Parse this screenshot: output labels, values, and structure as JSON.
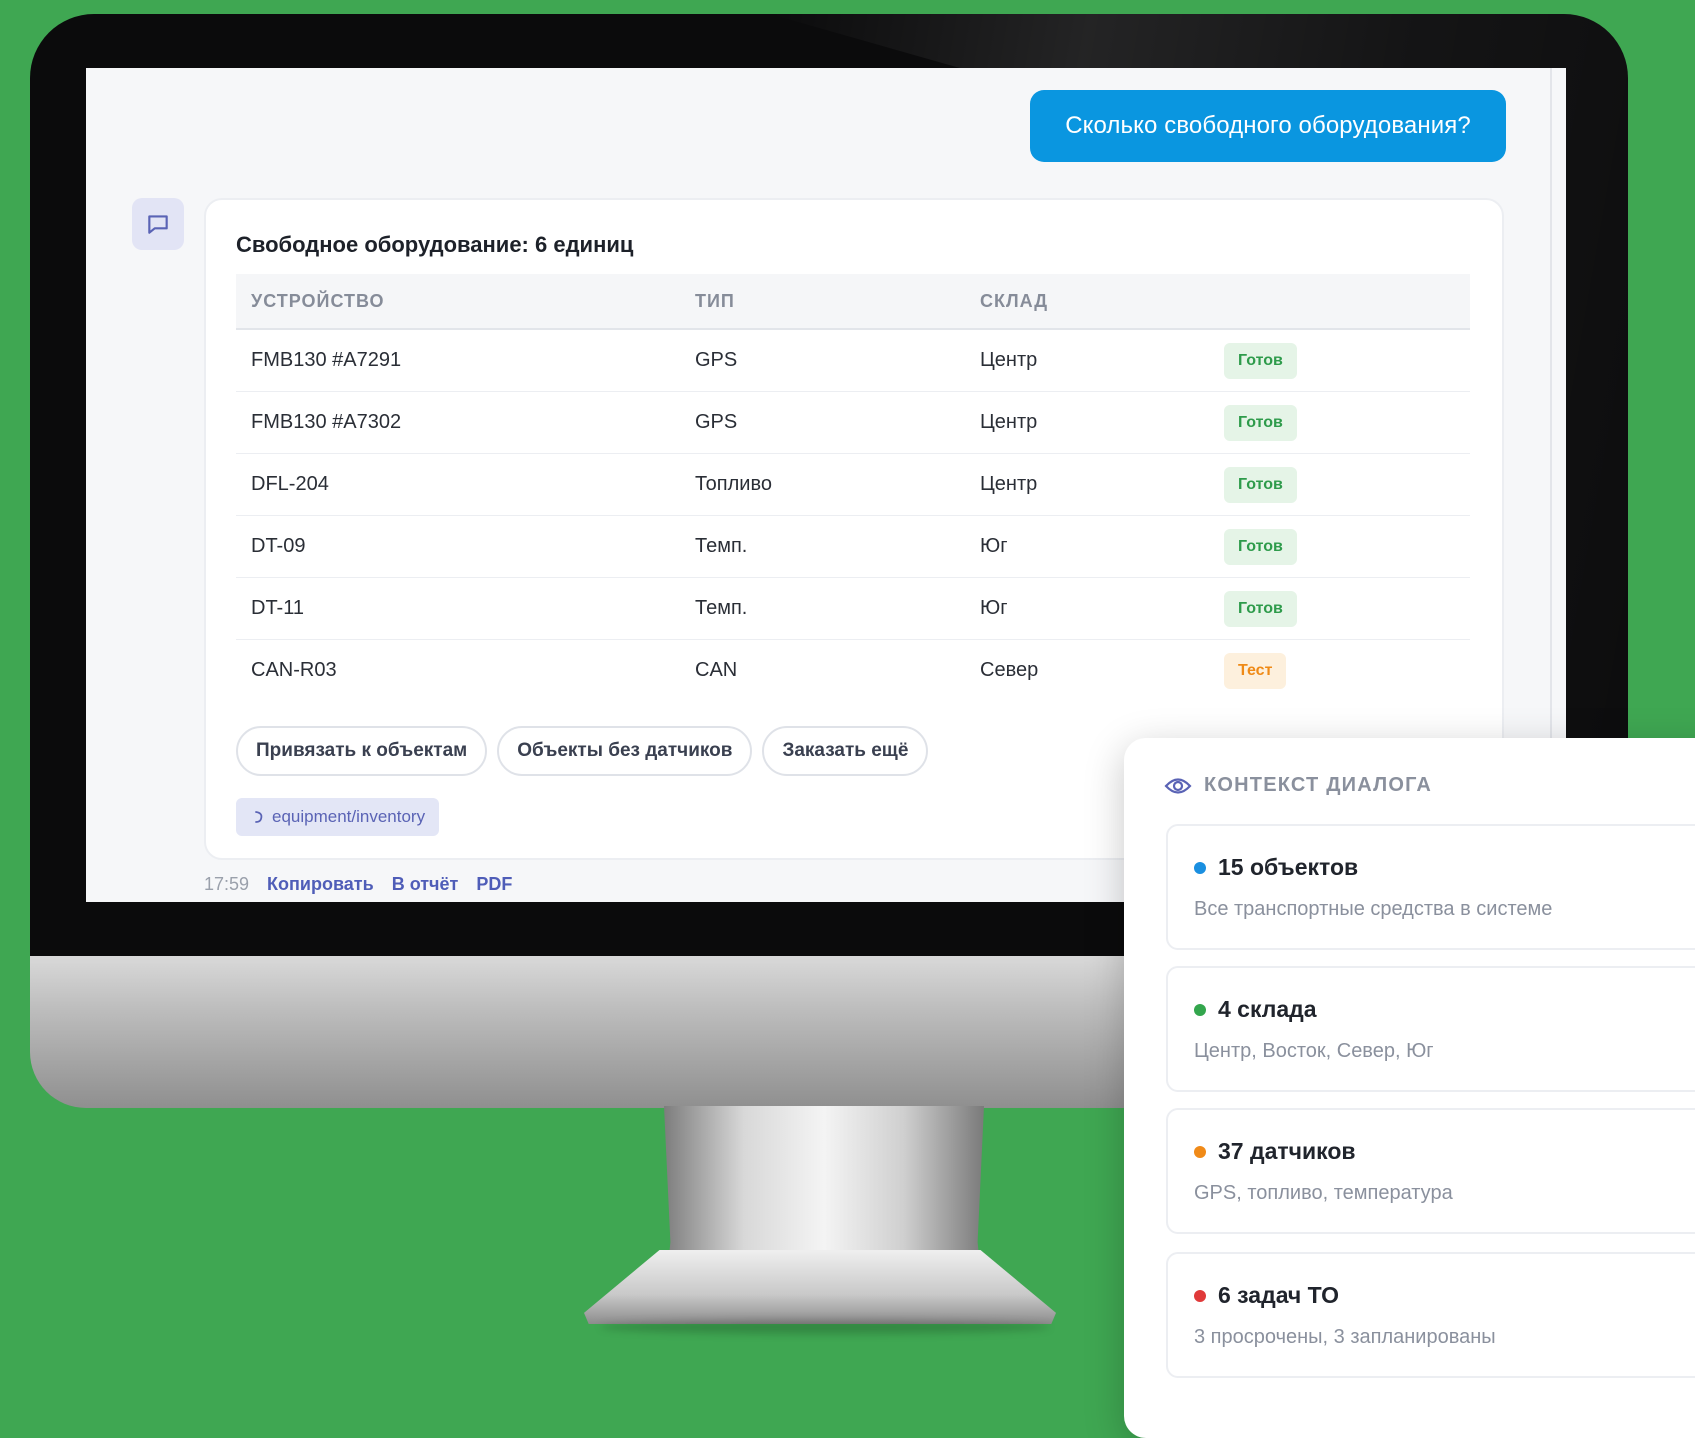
{
  "chat": {
    "user_message": "Сколько свободного оборудования?",
    "response_title": "Свободное оборудование: 6 единиц",
    "table": {
      "columns": [
        "УСТРОЙСТВО",
        "ТИП",
        "СКЛАД"
      ],
      "rows": [
        {
          "device": "FMB130 #A7291",
          "type": "GPS",
          "warehouse": "Центр",
          "status": "Готов"
        },
        {
          "device": "FMB130 #A7302",
          "type": "GPS",
          "warehouse": "Центр",
          "status": "Готов"
        },
        {
          "device": "DFL-204",
          "type": "Топливо",
          "warehouse": "Центр",
          "status": "Готов"
        },
        {
          "device": "DT-09",
          "type": "Темп.",
          "warehouse": "Юг",
          "status": "Готов"
        },
        {
          "device": "DT-11",
          "type": "Темп.",
          "warehouse": "Юг",
          "status": "Готов"
        },
        {
          "device": "CAN-R03",
          "type": "CAN",
          "warehouse": "Север",
          "status": "Тест"
        }
      ]
    },
    "actions": [
      "Привязать к объектам",
      "Объекты без датчиков",
      "Заказать ещё"
    ],
    "source_tag": "equipment/inventory",
    "meta": {
      "time": "17:59",
      "copy": "Копировать",
      "to_report": "В отчёт",
      "pdf": "PDF"
    }
  },
  "context": {
    "title": "КОНТЕКСТ ДИАЛОГА",
    "cards": [
      {
        "title": "15 объектов",
        "subtitle": "Все транспортные средства в системе",
        "color": "#1a8fe0"
      },
      {
        "title": "4 склада",
        "subtitle": "Центр, Восток, Север, Юг",
        "color": "#33a64d"
      },
      {
        "title": "37 датчиков",
        "subtitle": "GPS, топливо, температура",
        "color": "#f08a18"
      },
      {
        "title": "6 задач ТО",
        "subtitle": "3 просрочены, 3 запланированы",
        "color": "#e03a3a"
      }
    ]
  },
  "colors": {
    "background": "#3fa752",
    "user_bubble": "#0a96e0",
    "badge_ready_text": "#2e9b4b",
    "badge_test_text": "#ef8a16",
    "link": "#4f5db8"
  },
  "icons": {
    "bot_avatar": "chat-bubble-icon",
    "source_tag": "link-icon",
    "context_header": "eye-icon"
  }
}
